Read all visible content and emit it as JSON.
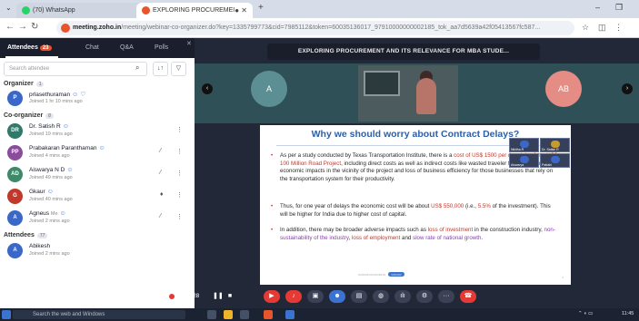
{
  "browser": {
    "tabs": [
      {
        "label": "(70) WhatsApp",
        "favicon_color": "#25d366"
      },
      {
        "label": "EXPLORING PROCUREMEI",
        "favicon_color": "#e8542c"
      }
    ],
    "new_tab": "+",
    "url_host": "meeting.zoho.in",
    "url_path": "/meeting/webinar-co-organizer.do?key=1335799773&cid=7985112&token=60035136017_97910000000002185_tok_aa7d5639a42f05413567fc587..."
  },
  "sidebar": {
    "tabs": {
      "attendees": "Attendees",
      "attendees_count": "23",
      "chat": "Chat",
      "qa": "Q&A",
      "polls": "Polls"
    },
    "search_placeholder": "Search attendee",
    "sections": {
      "organizer": "Organizer",
      "organizer_count": "1",
      "coorganizer": "Co-organizer",
      "coorganizer_count": "8",
      "attendees": "Attendees",
      "attendees_count": "77"
    },
    "people": [
      {
        "initials": "P",
        "name": "prlasethuraman",
        "joined": "Joined 1 hr 10 mins ago",
        "color": "#3a67c8"
      },
      {
        "initials": "DR",
        "name": "Dr. Satish R",
        "joined": "Joined 19 mins ago",
        "color": "#2f7a6a"
      },
      {
        "initials": "PP",
        "name": "Prabakaran Paranthaman",
        "joined": "Joined 4 mins ago",
        "color": "#8a4d9c"
      },
      {
        "initials": "AD",
        "name": "Aiswarya N D",
        "joined": "Joined 49 mins ago",
        "color": "#3c8a6a"
      },
      {
        "initials": "G",
        "name": "Gkaur",
        "joined": "Joined 40 mins ago",
        "color": "#c0392b"
      },
      {
        "initials": "A",
        "name": "Agneus",
        "tag": "Me",
        "joined": "Joined 2 mins ago",
        "color": "#3a67c8"
      },
      {
        "initials": "A",
        "name": "Abikesh",
        "joined": "Joined 2 mins ago",
        "color": "#3a67c8"
      }
    ]
  },
  "webinar": {
    "title": "EXPLORING PROCUREMENT AND ITS RELEVANCE FOR MBA STUDE...",
    "left_avatar": "A",
    "right_avatar": "AB",
    "slide": {
      "title": "Why we should worry about Contract Delays?",
      "b1_a": "As per a study conducted by Texas Transportation Institute, there is a ",
      "b1_b": "cost of US$ 1500 per day delay for a US$ 100 Million Road Project",
      "b1_c": ", including direct costs as well as indirect costs like wasted traveler fuel and time, economic impacts in the vicinity of the project and loss of business efficiency for those businesses that rely on the transportation system for their productivity.",
      "b2_a": "Thus, for one year of delays the economic cost will be about ",
      "b2_b": "US$ 550,000",
      "b2_c": " (i.e., ",
      "b2_d": "5.5%",
      "b2_e": " of the investment). This will be higher for India due to higher cost of capital.",
      "b3_a": "In addition, there may be broader adverse impacts such as ",
      "b3_b": "loss of investment",
      "b3_c": " in the construction industry, ",
      "b3_d": "non-sustainability of the industry",
      "b3_e": ", ",
      "b3_f": "loss of employment",
      "b3_g": " and ",
      "b3_h": "slow rate of national growth",
      "b3_i": "."
    },
    "tiles": [
      {
        "name": "Nikitha R",
        "color": "#3a67c8"
      },
      {
        "name": "Dr. Satish R",
        "color": "#c79a2c"
      },
      {
        "name": "Aiswarya",
        "color": "#3a67c8"
      },
      {
        "name": "Pattabi",
        "color": "#3a67c8"
      }
    ]
  },
  "controls": {
    "timer": "05:10:28"
  },
  "taskbar": {
    "search": "Search the web and Windows",
    "time": "11:45"
  },
  "colors": {
    "accent": "#e8542c",
    "slide_title": "#2d5fa6",
    "highlight_red": "#c0392b"
  }
}
